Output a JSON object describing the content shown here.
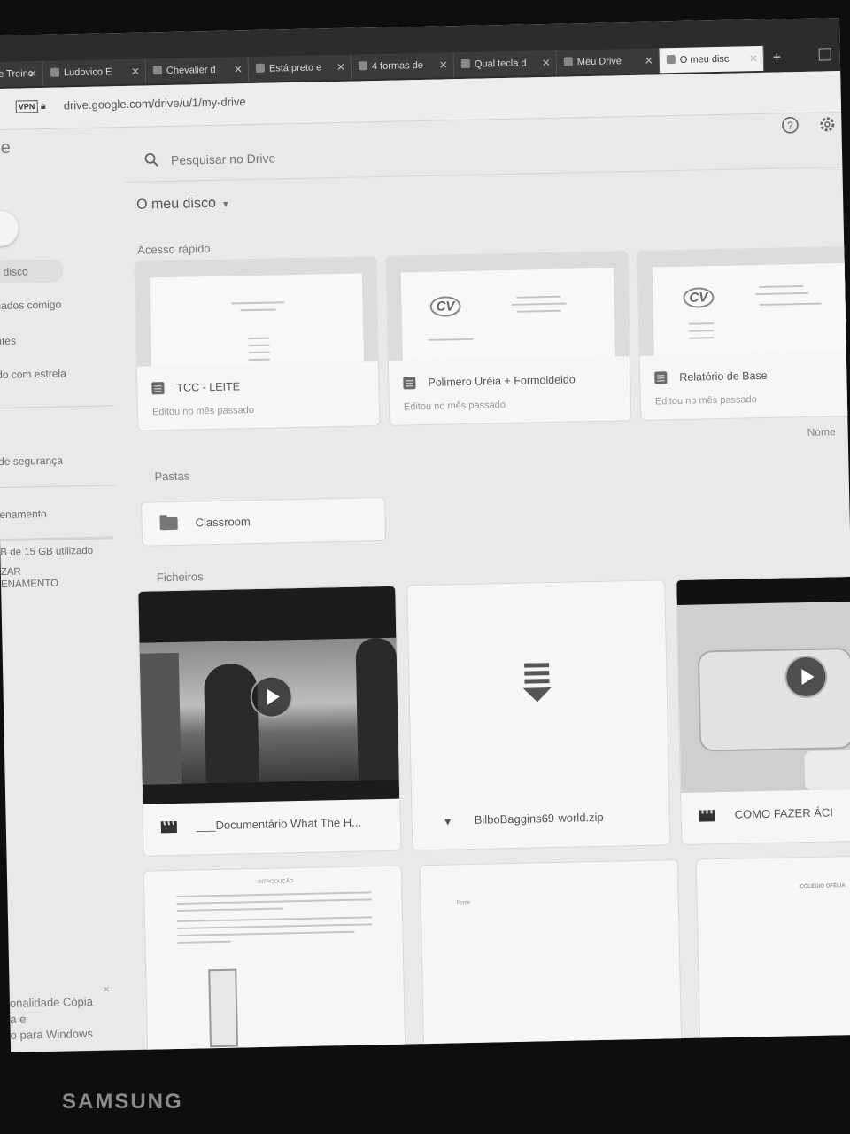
{
  "browser": {
    "tabs": [
      {
        "label": "de Treino"
      },
      {
        "label": "Ludovico E"
      },
      {
        "label": "Chevalier d"
      },
      {
        "label": "Está preto e"
      },
      {
        "label": "4 formas de"
      },
      {
        "label": "Qual tecla d"
      },
      {
        "label": "Meu Drive"
      },
      {
        "label": "O meu disc"
      }
    ],
    "new_tab": "+",
    "vpn_badge": "VPN",
    "url": "drive.google.com/drive/u/1/my-drive"
  },
  "header": {
    "brand": "ve",
    "search_placeholder": "Pesquisar no Drive"
  },
  "sidebar": {
    "items": [
      {
        "label": "u disco"
      },
      {
        "label": "hados comigo"
      },
      {
        "label": "ntes"
      },
      {
        "label": "do com estrela"
      },
      {
        "label": "de segurança"
      },
      {
        "label": "enamento"
      },
      {
        "label": "B de 15 GB utilizado"
      },
      {
        "label": "ZAR"
      },
      {
        "label": "ENAMENTO"
      }
    ]
  },
  "main": {
    "title": "O meu disco",
    "quick_access_title": "Acesso rápido",
    "quick_access": [
      {
        "name": "TCC - LEITE",
        "subtitle": "Editou no mês passado"
      },
      {
        "name": "Polimero Uréia + Formoldeido",
        "subtitle": "Editou no mês passado"
      },
      {
        "name": "Relatório de Base",
        "subtitle": "Editou no mês passado"
      }
    ],
    "sort_label": "Nome",
    "folders_title": "Pastas",
    "folders": [
      {
        "name": "Classroom"
      }
    ],
    "files_title": "Ficheiros",
    "files": [
      {
        "name": "___Documentário What The H..."
      },
      {
        "name": "BilboBaggins69-world.zip"
      },
      {
        "name": "COMO FAZER ÁCI"
      }
    ],
    "doc_previews": [
      {
        "heading": "INTRODUÇÃO"
      },
      {
        "heading": "Fonte"
      },
      {
        "heading": "COLÉGIO OFÉLIA"
      }
    ]
  },
  "popup": {
    "lines": [
      "onalidade Cópia",
      "a e",
      "o para Windows"
    ],
    "close": "×"
  },
  "device": {
    "brand": "SAMSUNG"
  },
  "colors": {
    "screen_bg": "#e9e9e9",
    "card_bg": "#f6f6f6",
    "bezel": "#0e0e0e"
  }
}
